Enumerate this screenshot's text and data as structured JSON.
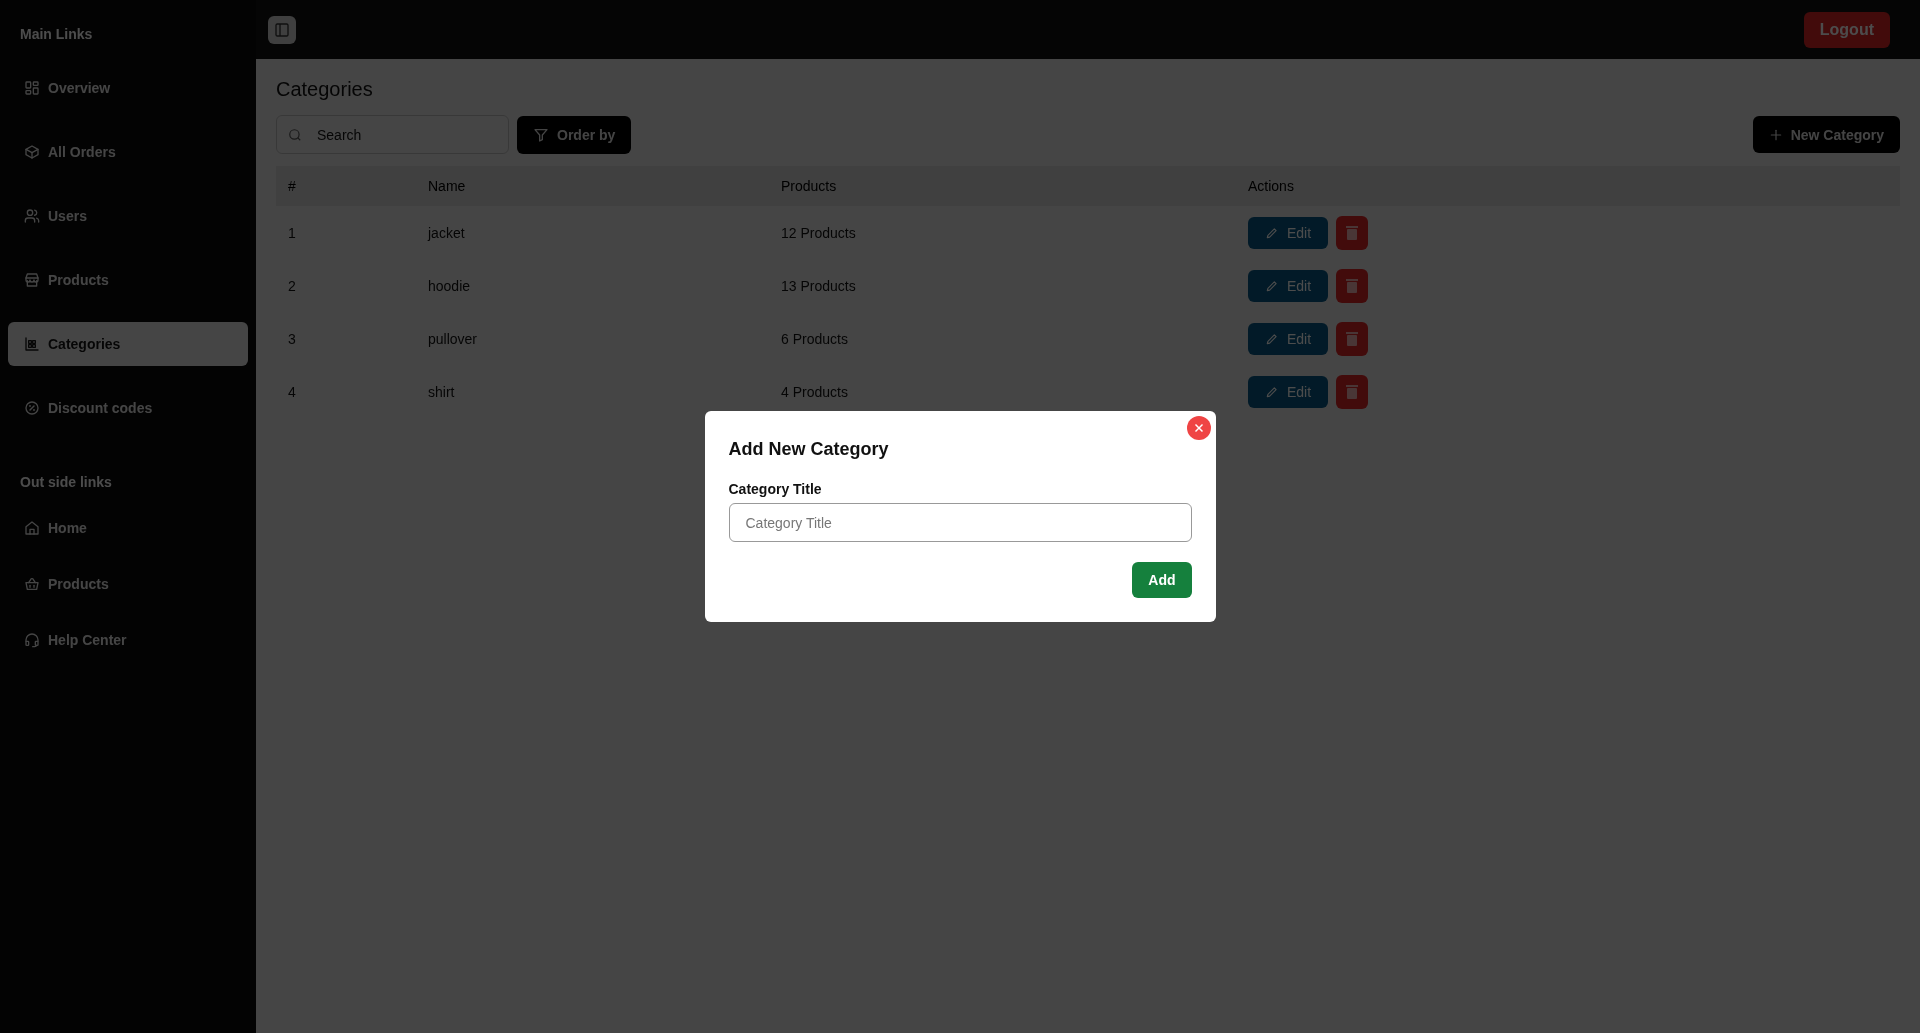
{
  "sidebar": {
    "sections": [
      {
        "heading": "Main Links",
        "items": [
          {
            "label": "Overview",
            "selected": false
          },
          {
            "label": "All Orders",
            "selected": false
          },
          {
            "label": "Users",
            "selected": false
          },
          {
            "label": "Products",
            "selected": false
          },
          {
            "label": "Categories",
            "selected": true
          },
          {
            "label": "Discount codes",
            "selected": false
          }
        ]
      },
      {
        "heading": "Out side links",
        "items": [
          {
            "label": "Home",
            "selected": false
          },
          {
            "label": "Products",
            "selected": false
          },
          {
            "label": "Help Center",
            "selected": false
          }
        ]
      }
    ]
  },
  "topbar": {
    "logout": "Logout"
  },
  "page": {
    "title": "Categories",
    "search": {
      "placeholder": "Search"
    },
    "order_by": "Order by",
    "new_button": "New Category"
  },
  "table": {
    "columns": [
      "#",
      "Name",
      "Products",
      "Actions"
    ],
    "rows": [
      {
        "index": "1",
        "name": "jacket",
        "products": "12 Products",
        "edit": "Edit"
      },
      {
        "index": "2",
        "name": "hoodie",
        "products": "13 Products",
        "edit": "Edit"
      },
      {
        "index": "3",
        "name": "pullover",
        "products": "6 Products",
        "edit": "Edit"
      },
      {
        "index": "4",
        "name": "shirt",
        "products": "4 Products",
        "edit": "Edit"
      }
    ]
  },
  "modal": {
    "title": "Add New Category",
    "field_label": "Category Title",
    "placeholder": "Category Title",
    "submit": "Add"
  }
}
